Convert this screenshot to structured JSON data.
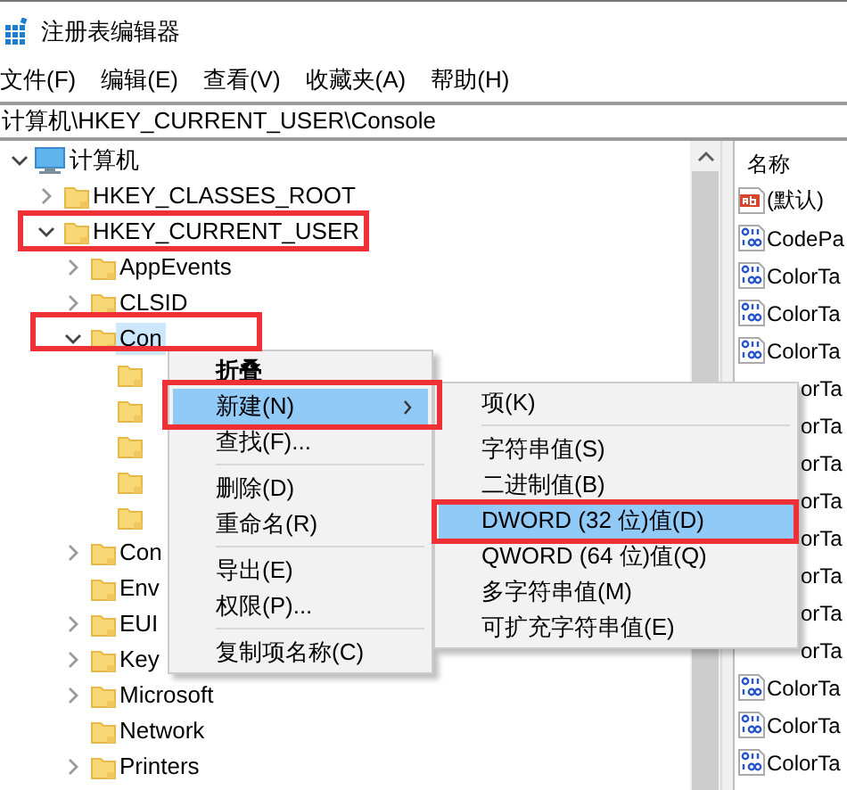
{
  "window": {
    "title": "注册表编辑器"
  },
  "menu": [
    {
      "label": "文件(F)"
    },
    {
      "label": "编辑(E)"
    },
    {
      "label": "查看(V)"
    },
    {
      "label": "收藏夹(A)"
    },
    {
      "label": "帮助(H)"
    }
  ],
  "address": "计算机\\HKEY_CURRENT_USER\\Console",
  "tree": [
    {
      "label": "计算机",
      "kind": "computer",
      "expanded": true,
      "selected": false,
      "children": [
        {
          "label": "HKEY_CLASSES_ROOT",
          "kind": "folder",
          "expanded": false,
          "selected": false
        },
        {
          "label": "HKEY_CURRENT_USER",
          "kind": "folder",
          "expanded": true,
          "selected": false,
          "children": [
            {
              "label": "AppEvents",
              "kind": "folder",
              "expanded": false,
              "selected": false
            },
            {
              "label": "CLSID",
              "kind": "folder",
              "expanded": false,
              "selected": false
            },
            {
              "label": "Con",
              "kind": "folder",
              "expanded": true,
              "selected": true,
              "children": [
                {
                  "kind": "folder"
                },
                {
                  "kind": "folder"
                },
                {
                  "kind": "folder"
                },
                {
                  "kind": "folder"
                },
                {
                  "kind": "folder"
                }
              ]
            },
            {
              "label": "Con",
              "kind": "folder",
              "expanded": false,
              "selected": false
            },
            {
              "label": "Env",
              "kind": "folder",
              "selected": false
            },
            {
              "label": "EUI",
              "kind": "folder",
              "expanded": false,
              "selected": false
            },
            {
              "label": "Key",
              "kind": "folder",
              "expanded": false,
              "selected": false
            },
            {
              "label": "Microsoft",
              "kind": "folder",
              "expanded": false,
              "selected": false
            },
            {
              "label": "Network",
              "kind": "folder",
              "selected": false
            },
            {
              "label": "Printers",
              "kind": "folder",
              "expanded": false,
              "selected": false
            }
          ]
        }
      ]
    }
  ],
  "values": {
    "columns": [
      "名称"
    ],
    "rows": [
      {
        "name": "(默认)",
        "kind": "string"
      },
      {
        "name": "CodePa",
        "kind": "dword"
      },
      {
        "name": "ColorTa",
        "kind": "dword"
      },
      {
        "name": "ColorTa",
        "kind": "dword"
      },
      {
        "name": "ColorTa",
        "kind": "dword"
      },
      {
        "name": "orTa"
      },
      {
        "name": "orTa"
      },
      {
        "name": "orTa"
      },
      {
        "name": "orTa"
      },
      {
        "name": "orTa"
      },
      {
        "name": "orTa"
      },
      {
        "name": "orTa"
      },
      {
        "name": "orTa"
      },
      {
        "name": "ColorTa",
        "kind": "dword"
      },
      {
        "name": "ColorTa",
        "kind": "dword"
      },
      {
        "name": "ColorTa",
        "kind": "dword"
      }
    ]
  },
  "context_menu": {
    "items": [
      {
        "kind": "default",
        "label": "折叠",
        "selected": false
      },
      {
        "kind": "item",
        "label": "新建(N)",
        "submenu": true,
        "selected": true
      },
      {
        "kind": "item",
        "label": "查找(F)...",
        "selected": false
      },
      {
        "kind": "separator"
      },
      {
        "kind": "item",
        "label": "删除(D)",
        "selected": false
      },
      {
        "kind": "item",
        "label": "重命名(R)",
        "selected": false
      },
      {
        "kind": "separator"
      },
      {
        "kind": "item",
        "label": "导出(E)",
        "selected": false
      },
      {
        "kind": "item",
        "label": "权限(P)...",
        "selected": false
      },
      {
        "kind": "separator"
      },
      {
        "kind": "item",
        "label": "复制项名称(C)",
        "selected": false
      }
    ]
  },
  "submenu": {
    "items": [
      {
        "kind": "item",
        "label": "项(K)",
        "selected": false
      },
      {
        "kind": "separator"
      },
      {
        "kind": "item",
        "label": "字符串值(S)",
        "selected": false
      },
      {
        "kind": "item",
        "label": "二进制值(B)",
        "selected": false
      },
      {
        "kind": "item",
        "label": "DWORD (32 位)值(D)",
        "selected": true
      },
      {
        "kind": "item",
        "label": "QWORD (64 位)值(Q)",
        "selected": false
      },
      {
        "kind": "item",
        "label": "多字符串值(M)",
        "selected": false
      },
      {
        "kind": "item",
        "label": "可扩充字符串值(E)",
        "selected": false
      }
    ]
  }
}
